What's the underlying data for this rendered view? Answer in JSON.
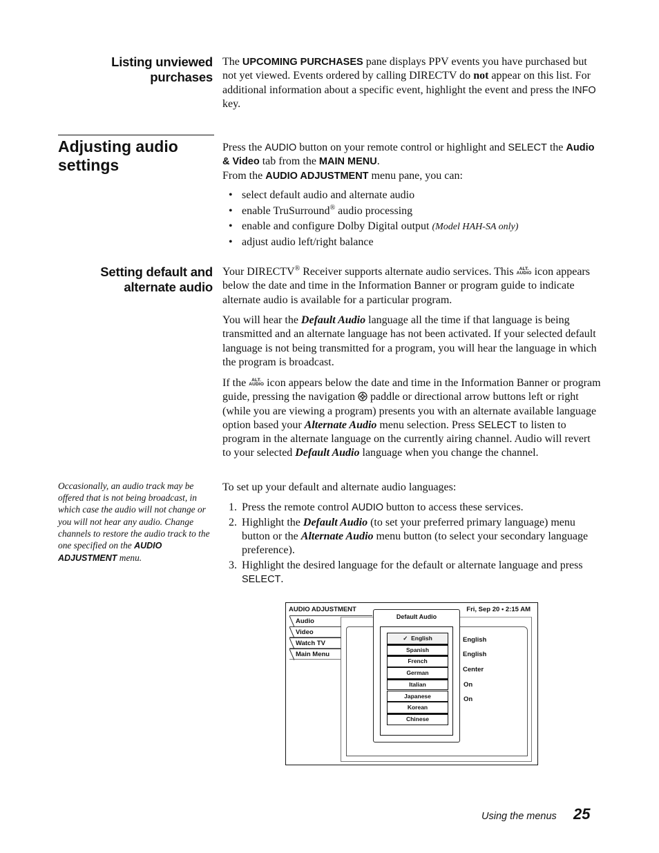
{
  "sections": {
    "listing": {
      "heading_line1": "Listing unviewed",
      "heading_line2": "purchases",
      "text": {
        "t1": "The ",
        "upcoming": "UPCOMING PURCHASES",
        "t2": " pane displays PPV events you have purchased but not yet viewed. Events ordered by calling DIRECTV do ",
        "not": "not",
        "t3": " appear on this list. For additional information about a specific event, highlight the event and press the ",
        "info": "INFO",
        "t4": " key."
      }
    },
    "adjusting": {
      "heading_line1": "Adjusting audio",
      "heading_line2": "settings",
      "intro": {
        "t1": "Press the ",
        "audio": "AUDIO",
        "t2": " button on your remote control or highlight and ",
        "select": "SELECT",
        "t3": " the ",
        "audio_video": "Audio & Video",
        "t4": " tab from the ",
        "main_menu": "MAIN MENU",
        "t5": ".",
        "t6": "From the ",
        "audio_adjustment": "AUDIO ADJUSTMENT",
        "t7": " menu pane, you can:"
      },
      "bullets": [
        {
          "text": "select default audio and alternate audio"
        },
        {
          "pre": "enable TruSurround",
          "sup": "®",
          "post": " audio processing"
        },
        {
          "text": "enable and configure Dolby Digital output ",
          "note": "(Model HAH-SA only)"
        },
        {
          "text": "adjust audio left/right balance"
        }
      ]
    },
    "setting": {
      "heading_line1": "Setting default and",
      "heading_line2": "alternate audio",
      "p1": {
        "t1": "Your DIRECTV",
        "reg": "®",
        "t2": " Receiver supports alternate audio services. This ",
        "t3": " icon appears below the date and time in the Information Banner or program guide to indicate alternate audio is available for a particular program."
      },
      "p2": {
        "t1": "You will hear the ",
        "default_audio": "Default Audio",
        "t2": " language all the time if that language is being transmitted and an alternate language has not been activated. If your selected default language is not being transmitted for a program, you will hear the language in which the program is broadcast."
      },
      "p3": {
        "t1": "If the ",
        "t2": " icon appears below the date and time in the Information Banner or program guide, pressing the navigation ",
        "t3": " paddle or directional arrow buttons left or right (while you are viewing a program) presents you with an alternate available language option based your ",
        "alternate_audio": "Alternate Audio",
        "t4": " menu selection. Press ",
        "select": "SELECT",
        "t5": " to listen to program in the alternate language on the currently airing channel. Audio will revert to your selected ",
        "default_audio": "Default Audio",
        "t6": " language when you change the channel."
      },
      "p4": "To set up your default and alternate audio languages:",
      "steps": [
        {
          "num": "1.",
          "t1": "Press the remote control ",
          "k1": "AUDIO",
          "t2": " button to access these services."
        },
        {
          "num": "2.",
          "t1": "Highlight the ",
          "k1": "Default Audio",
          "t2": " (to set your preferred primary language) menu button or the ",
          "k2": "Alternate Audio",
          "t3": " menu button (to select your secondary language preference)."
        },
        {
          "num": "3.",
          "t1": "Highlight the desired language for the default or alternate language and press ",
          "k1": "SELECT",
          "t2": "."
        }
      ],
      "sidebar_note": {
        "text": "Occasionally, an audio track may be offered that is not being broadcast, in which case the audio will not change or you will not hear any audio. Change channels to restore the audio track to the one specified on the ",
        "menu_name": "AUDIO ADJUSTMENT",
        "suffix": " menu."
      }
    }
  },
  "icons": {
    "alt_audio_line1": "ALT.",
    "alt_audio_line2": "AUDIO"
  },
  "screen": {
    "title": "AUDIO ADJUSTMENT",
    "datetime": "Fri, Sep 20 •  2:15 AM",
    "tabs": [
      "Audio",
      "Video",
      "Watch TV",
      "Main Menu"
    ],
    "active_tab": "Audio",
    "popup": {
      "title": "Default Audio",
      "check": "✓",
      "languages": [
        "English",
        "Spanish",
        "French",
        "German",
        "Italian",
        "Japanese",
        "Korean",
        "Chinese"
      ],
      "selected": "English"
    },
    "values": [
      "English",
      "English",
      "Center",
      "On",
      "On"
    ]
  },
  "footer": {
    "section": "Using the menus",
    "page_number": "25"
  }
}
